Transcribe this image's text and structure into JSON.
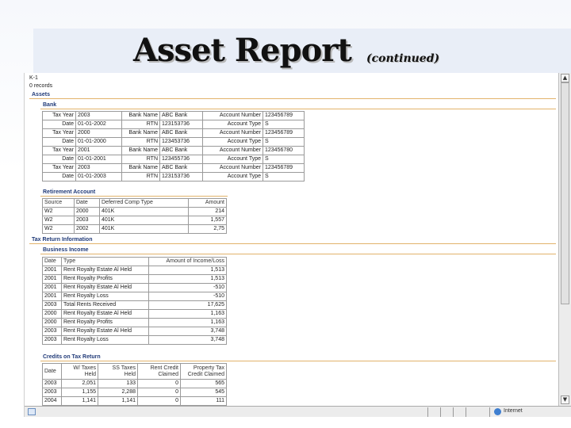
{
  "slide": {
    "title": "Asset Report",
    "subtitle": "(continued)"
  },
  "report": {
    "k1_heading": "K-1",
    "k1_records": "0 records",
    "assets_heading": "Assets",
    "bank_heading": "Bank",
    "bank_labels": {
      "tax_year": "Tax Year",
      "date": "Date",
      "bank_name": "Bank Name",
      "rtn": "RTN",
      "account_number": "Account Number",
      "account_type": "Account Type"
    },
    "bank_rows": [
      {
        "year": "2003",
        "bank_name": "ABC Bank",
        "account_number": "123456789",
        "date": "01-01-2002",
        "rtn": "123153736",
        "account_type": "S"
      },
      {
        "year": "2000",
        "bank_name": "ABC Bank",
        "account_number": "123456789",
        "date": "01-01-2000",
        "rtn": "123453736",
        "account_type": "S"
      },
      {
        "year": "2001",
        "bank_name": "ABC Bank",
        "account_number": "123456780",
        "date": "01-01-2001",
        "rtn": "123455736",
        "account_type": "S"
      },
      {
        "year": "2003",
        "bank_name": "ABC Bank",
        "account_number": "123456789",
        "date": "01-01-2003",
        "rtn": "123153736",
        "account_type": "S"
      }
    ],
    "retirement_heading": "Retirement Account",
    "retirement_columns": [
      "Source",
      "Date",
      "Deferred Comp Type",
      "Amount"
    ],
    "retirement_rows": [
      [
        "W2",
        "2000",
        "401K",
        "214"
      ],
      [
        "W2",
        "2003",
        "401K",
        "1,557"
      ],
      [
        "W2",
        "2002",
        "401K",
        "2,75"
      ]
    ],
    "tax_return_heading": "Tax Return Information",
    "business_income_heading": "Business Income",
    "business_columns": [
      "Date",
      "Type",
      "Amount of Income/Loss"
    ],
    "business_rows": [
      [
        "2001",
        "Rent Royalty Estate Al Held",
        "1,513"
      ],
      [
        "2001",
        "Rent Royalty Profits",
        "1,513"
      ],
      [
        "2001",
        "Rent Royalty Estate Al Held",
        "-510"
      ],
      [
        "2001",
        "Rent Royalty Loss",
        "-510"
      ],
      [
        "2003",
        "Total Rents Received",
        "17,625"
      ],
      [
        "2000",
        "Rent Royalty Estate Al Held",
        "1,163"
      ],
      [
        "2000",
        "Rent Royalty Profits",
        "1,163"
      ],
      [
        "2003",
        "Rent Royalty Estate Al Held",
        "3,748"
      ],
      [
        "2003",
        "Rent Royalty Loss",
        "3,748"
      ]
    ],
    "credits_heading": "Credits on Tax Return",
    "credits_columns": [
      "Date",
      "W/ Taxes Held",
      "SS Taxes Held",
      "Rent Credit Claimed",
      "Property Tax Credit Claimed"
    ],
    "credits_rows": [
      [
        "2003",
        "2,051",
        "133",
        "0",
        "565"
      ],
      [
        "2003",
        "1,155",
        "2,288",
        "0",
        "545"
      ],
      [
        "2004",
        "1,141",
        "1,141",
        "0",
        "111"
      ]
    ]
  },
  "statusbar": {
    "zone": "Internet"
  },
  "scrollbar": {
    "up_arrow": "▲",
    "down_arrow": "▼"
  }
}
